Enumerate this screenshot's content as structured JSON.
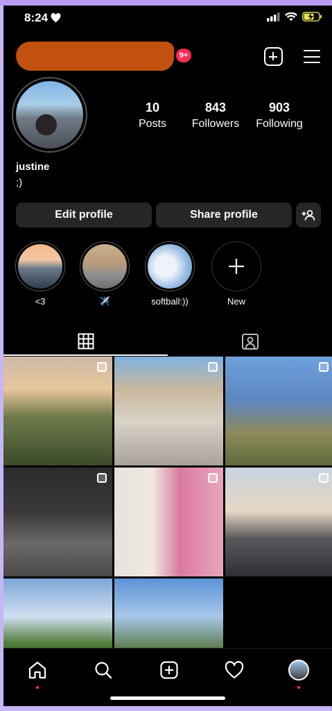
{
  "status_bar": {
    "time": "8:24"
  },
  "header": {
    "notification_badge": "9+"
  },
  "profile": {
    "posts_count": "10",
    "posts_label": "Posts",
    "followers_count": "843",
    "followers_label": "Followers",
    "following_count": "903",
    "following_label": "Following",
    "name": "justine",
    "bio": ";)"
  },
  "actions": {
    "edit_label": "Edit profile",
    "share_label": "Share profile"
  },
  "highlights": [
    {
      "label": "<3"
    },
    {
      "label": "✈️"
    },
    {
      "label": "softball:))"
    },
    {
      "label": "New"
    }
  ],
  "colors": {
    "accent_badge": "#ff2c55",
    "button_bg": "#262626",
    "redaction": "#c2500f"
  },
  "icons": [
    "heart-icon",
    "signal-icon",
    "wifi-icon",
    "battery-charging-icon",
    "new-post-icon",
    "menu-icon",
    "add-person-icon",
    "plus-icon",
    "grid-icon",
    "tagged-icon",
    "home-icon",
    "search-icon",
    "create-icon",
    "activity-heart-icon",
    "profile-avatar-icon",
    "multiple-photos-icon"
  ]
}
